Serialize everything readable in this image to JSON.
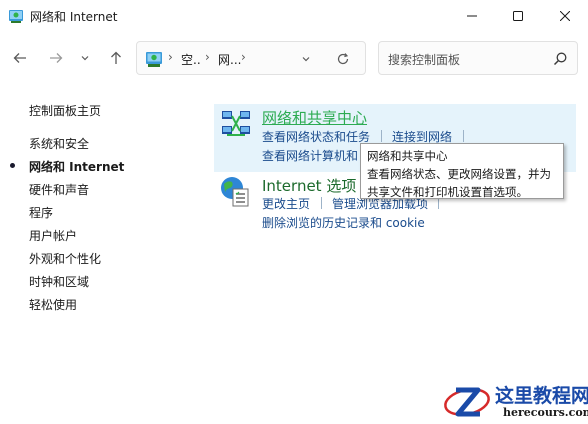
{
  "window": {
    "title": "网络和 Internet",
    "controls": {
      "minimize": "minimize-icon",
      "maximize": "maximize-icon",
      "close": "close-icon"
    }
  },
  "navbar": {
    "breadcrumbs": [
      "空..",
      "网..."
    ],
    "search_placeholder": "搜索控制面板"
  },
  "sidebar": {
    "items": [
      {
        "label": "控制面板主页",
        "active": false
      },
      {
        "label": "系统和安全",
        "active": false
      },
      {
        "label": "网络和 Internet",
        "active": true
      },
      {
        "label": "硬件和声音",
        "active": false
      },
      {
        "label": "程序",
        "active": false
      },
      {
        "label": "用户帐户",
        "active": false
      },
      {
        "label": "外观和个性化",
        "active": false
      },
      {
        "label": "时钟和区域",
        "active": false
      },
      {
        "label": "轻松使用",
        "active": false
      }
    ]
  },
  "categories": [
    {
      "title": "网络和共享中心",
      "icon": "network-sharing-center-icon",
      "links": [
        "查看网络状态和任务",
        "连接到网络",
        "查看网络计算机和设备"
      ],
      "link_visible": [
        "查看网络状态和任务",
        "连接到网络",
        "查看网络计算机和"
      ]
    },
    {
      "title": "Internet 选项",
      "title_visible": "Internet 选项",
      "icon": "internet-options-icon",
      "links": [
        "更改主页",
        "管理浏览器加载项",
        "删除浏览的历史记录和 cookie"
      ]
    }
  ],
  "tooltip": {
    "title": "网络和共享中心",
    "lines": [
      "查看网络状态、更改网络设置，并为",
      "共享文件和打印机设置首选项。"
    ]
  },
  "watermark": {
    "line1": "这里教程网",
    "line2": "herecours.com"
  },
  "colors": {
    "accent_link": "#1a4b8c",
    "category_hover": "#2dab52",
    "highlight_bg": "#e5f3fb"
  }
}
